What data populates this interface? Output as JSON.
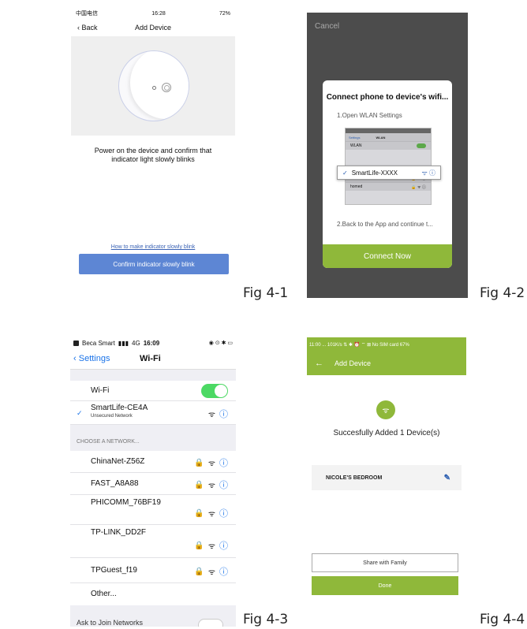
{
  "fig1": {
    "label": "Fig 4-1",
    "status": {
      "carrier": "中国电信",
      "time": "16:28",
      "battery": "72%"
    },
    "back": "Back",
    "title": "Add Device",
    "instruction": "Power on the device and confirm that indicator light slowly blinks",
    "help_link": "How to make indicator slowly blink",
    "confirm_button": "Confirm indicator slowly blink",
    "accent": "#5d86d4"
  },
  "fig2": {
    "label": "Fig 4-2",
    "cancel": "Cancel",
    "dialog_title": "Connect phone to device's wifi...",
    "step1": "1.Open WLAN Settings",
    "mini": {
      "back": "Settings",
      "title": "WLAN",
      "wlan": "WLAN",
      "home": "home",
      "homed": "homed"
    },
    "network": "SmartLife-XXXX",
    "step2": "2.Back to the App and continue t...",
    "connect_button": "Connect Now",
    "accent": "#8fb83a"
  },
  "fig3": {
    "label": "Fig 4-3",
    "status": {
      "carrier": "Beca Smart",
      "network": "4G",
      "time": "16:09"
    },
    "back": "Settings",
    "title": "Wi-Fi",
    "wifi_label": "Wi-Fi",
    "connected": {
      "name": "SmartLife-CE4A",
      "sub": "Unsecured Network"
    },
    "section": "CHOOSE A NETWORK...",
    "networks": [
      {
        "name": "ChinaNet-Z56Z"
      },
      {
        "name": "FAST_A8A88"
      },
      {
        "name": "PHICOMM_76BF19"
      },
      {
        "name": "TP-LINK_DD2F"
      },
      {
        "name": "TPGuest_f19"
      }
    ],
    "other": "Other...",
    "bottom_partial": "Ask to Join Networks"
  },
  "fig4": {
    "label": "Fig 4-4",
    "status": "11:00 ... 101K/s ⇅ ✱ ⏰ ⌔ ⊠ No SIM card 67%",
    "title": "Add Device",
    "success": "Succesfully Added 1 Device(s)",
    "device": "NICOLE'S BEDROOM",
    "share_button": "Share with Family",
    "done_button": "Done",
    "accent": "#8fb83a"
  }
}
